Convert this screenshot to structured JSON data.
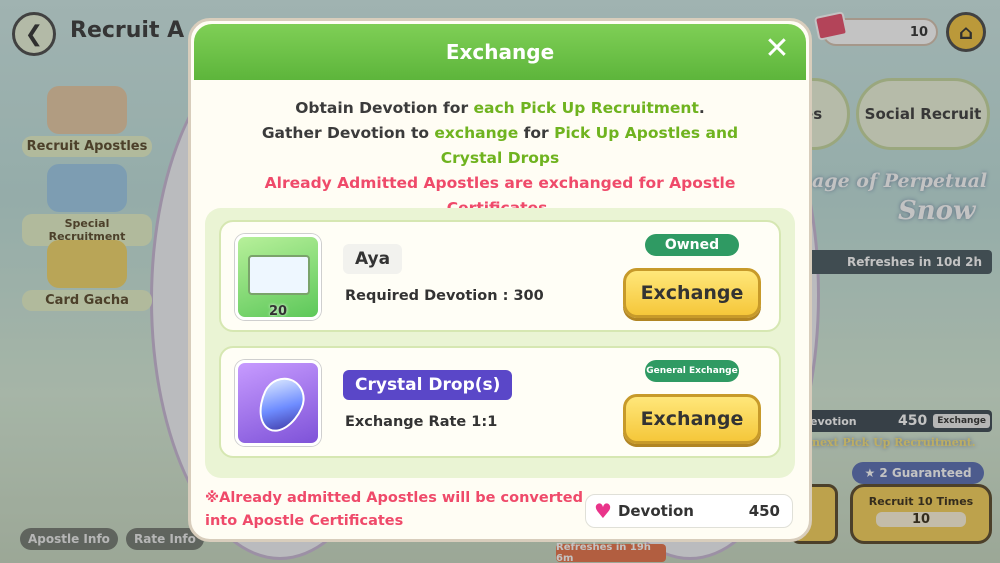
{
  "background": {
    "title": "Recruit A",
    "tickets": "10",
    "sidebar": [
      "Recruit Apostles",
      "Special Recruitment",
      "Card Gacha"
    ],
    "tabs": [
      "les",
      "Social Recruit"
    ],
    "banner_line1": "age of Perpetual",
    "banner_line2": "Snow",
    "refresh": "Refreshes in 10d 2h",
    "devotion_label": "evotion",
    "devotion_value": "450",
    "exchange_small": "Exchange",
    "pickup_note": "next Pick Up Recruitment.",
    "guaranteed": "2 Guaranteed",
    "recruit10": "Recruit 10 Times",
    "recruit10_cost": "10",
    "bottom_chips": [
      "Apostle Info",
      "Rate Info"
    ],
    "bottom_refresh": "Refreshes in 19h 6m"
  },
  "modal": {
    "title": "Exchange",
    "intro": {
      "l1a": "Obtain Devotion for ",
      "l1b": "each Pick Up Recruitment",
      "l1c": ".",
      "l2a": "Gather Devotion to ",
      "l2b": "exchange",
      "l2c": " for ",
      "l2d": "Pick Up Apostles and Crystal Drops",
      "l3": "Already Admitted Apostles are exchanged for Apostle Certificates."
    },
    "items": [
      {
        "name": "Aya",
        "desc": "Required Devotion : 300",
        "status": "Owned",
        "button": "Exchange",
        "count": "20"
      },
      {
        "name": "Crystal Drop(s)",
        "desc": "Exchange Rate 1:1",
        "status": "General Exchange",
        "button": "Exchange"
      }
    ],
    "footnote": "※Already admitted Apostles will be converted into Apostle Certificates",
    "devotion_label": "Devotion",
    "devotion_value": "450"
  }
}
